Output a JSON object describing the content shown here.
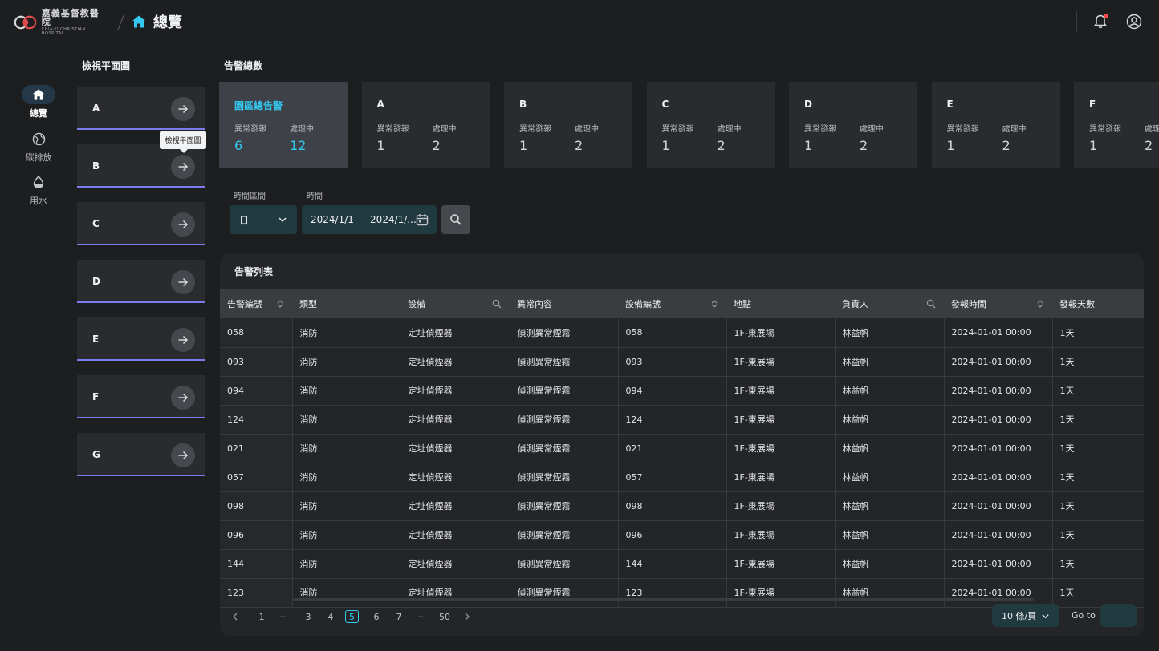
{
  "header": {
    "logo_cn": "嘉義基督教醫院",
    "logo_en": "CHIA-YI CHRISTIAN HOSPITAL",
    "page_title": "總覽"
  },
  "sidenav": [
    {
      "label": "總覽",
      "icon": "home-icon",
      "active": true
    },
    {
      "label": "碳排放",
      "icon": "globe-icon",
      "active": false
    },
    {
      "label": "用水",
      "icon": "water-drop-icon",
      "active": false
    }
  ],
  "floors": {
    "title": "檢視平面圖",
    "tooltip": "檢視平面圖",
    "items": [
      "A",
      "B",
      "C",
      "D",
      "E",
      "F",
      "G"
    ]
  },
  "alarms": {
    "title": "告警總數",
    "abnormal_label": "異常發報",
    "processing_label": "處理中",
    "cards": [
      {
        "name": "園區總告警",
        "abnormal": "6",
        "processing": "12"
      },
      {
        "name": "A",
        "abnormal": "1",
        "processing": "2"
      },
      {
        "name": "B",
        "abnormal": "1",
        "processing": "2"
      },
      {
        "name": "C",
        "abnormal": "1",
        "processing": "2"
      },
      {
        "name": "D",
        "abnormal": "1",
        "processing": "2"
      },
      {
        "name": "E",
        "abnormal": "1",
        "processing": "2"
      },
      {
        "name": "F",
        "abnormal": "1",
        "processing": "2"
      }
    ]
  },
  "filters": {
    "range_label": "時間區間",
    "time_label": "時間",
    "range_value": "日",
    "date_start": "2024/1/1",
    "date_end": "- 2024/1/..."
  },
  "table": {
    "title": "告警列表",
    "columns": [
      "告警編號",
      "類型",
      "設備",
      "異常內容",
      "設備編號",
      "地點",
      "負責人",
      "發報時間",
      "發報天數"
    ],
    "rows": [
      [
        "058",
        "消防",
        "定址偵煙器",
        "偵測異常煙霧",
        "058",
        "1F-東展場",
        "林益帆",
        "2024-01-01  00:00",
        "1天"
      ],
      [
        "093",
        "消防",
        "定址偵煙器",
        "偵測異常煙霧",
        "093",
        "1F-東展場",
        "林益帆",
        "2024-01-01  00:00",
        "1天"
      ],
      [
        "094",
        "消防",
        "定址偵煙器",
        "偵測異常煙霧",
        "094",
        "1F-東展場",
        "林益帆",
        "2024-01-01  00:00",
        "1天"
      ],
      [
        "124",
        "消防",
        "定址偵煙器",
        "偵測異常煙霧",
        "124",
        "1F-東展場",
        "林益帆",
        "2024-01-01  00:00",
        "1天"
      ],
      [
        "021",
        "消防",
        "定址偵煙器",
        "偵測異常煙霧",
        "021",
        "1F-東展場",
        "林益帆",
        "2024-01-01  00:00",
        "1天"
      ],
      [
        "057",
        "消防",
        "定址偵煙器",
        "偵測異常煙霧",
        "057",
        "1F-東展場",
        "林益帆",
        "2024-01-01  00:00",
        "1天"
      ],
      [
        "098",
        "消防",
        "定址偵煙器",
        "偵測異常煙霧",
        "098",
        "1F-東展場",
        "林益帆",
        "2024-01-01  00:00",
        "1天"
      ],
      [
        "096",
        "消防",
        "定址偵煙器",
        "偵測異常煙霧",
        "096",
        "1F-東展場",
        "林益帆",
        "2024-01-01  00:00",
        "1天"
      ],
      [
        "144",
        "消防",
        "定址偵煙器",
        "偵測異常煙霧",
        "144",
        "1F-東展場",
        "林益帆",
        "2024-01-01  00:00",
        "1天"
      ],
      [
        "123",
        "消防",
        "定址偵煙器",
        "偵測異常煙霧",
        "123",
        "1F-東展場",
        "林益帆",
        "2024-01-01  00:00",
        "1天"
      ]
    ]
  },
  "pagination": {
    "pages": [
      "1",
      "···",
      "3",
      "4",
      "5",
      "6",
      "7",
      "···",
      "50"
    ],
    "current": "5",
    "per_page": "10 條/頁",
    "goto_label": "Go to"
  },
  "colors": {
    "accent": "#35c8ef",
    "floor_underline": "#7b7cf0",
    "notification_dot": "#ff4b4b"
  }
}
